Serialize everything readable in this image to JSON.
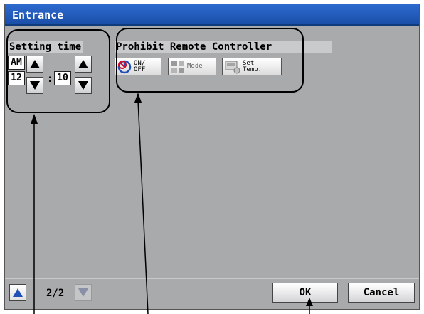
{
  "window": {
    "title": "Entrance"
  },
  "setting_time": {
    "label": "Setting time",
    "ampm": "AM",
    "hour": "12",
    "separator": ":",
    "minute": "10"
  },
  "prohibit": {
    "label": "Prohibit Remote Controller",
    "buttons": [
      {
        "icon": "power-prohibit-icon",
        "label": "ON/\nOFF"
      },
      {
        "icon": "mode-icon",
        "label": "Mode"
      },
      {
        "icon": "set-temp-icon",
        "label": "Set\nTemp."
      }
    ]
  },
  "footer": {
    "page": "2/2",
    "ok_label": "OK",
    "cancel_label": "Cancel"
  },
  "colors": {
    "titlebar": "#1a4fa8",
    "panel": "#a9aaac",
    "page_arrow_active": "#1e50b8",
    "page_arrow_disabled": "#8a8fa8"
  }
}
